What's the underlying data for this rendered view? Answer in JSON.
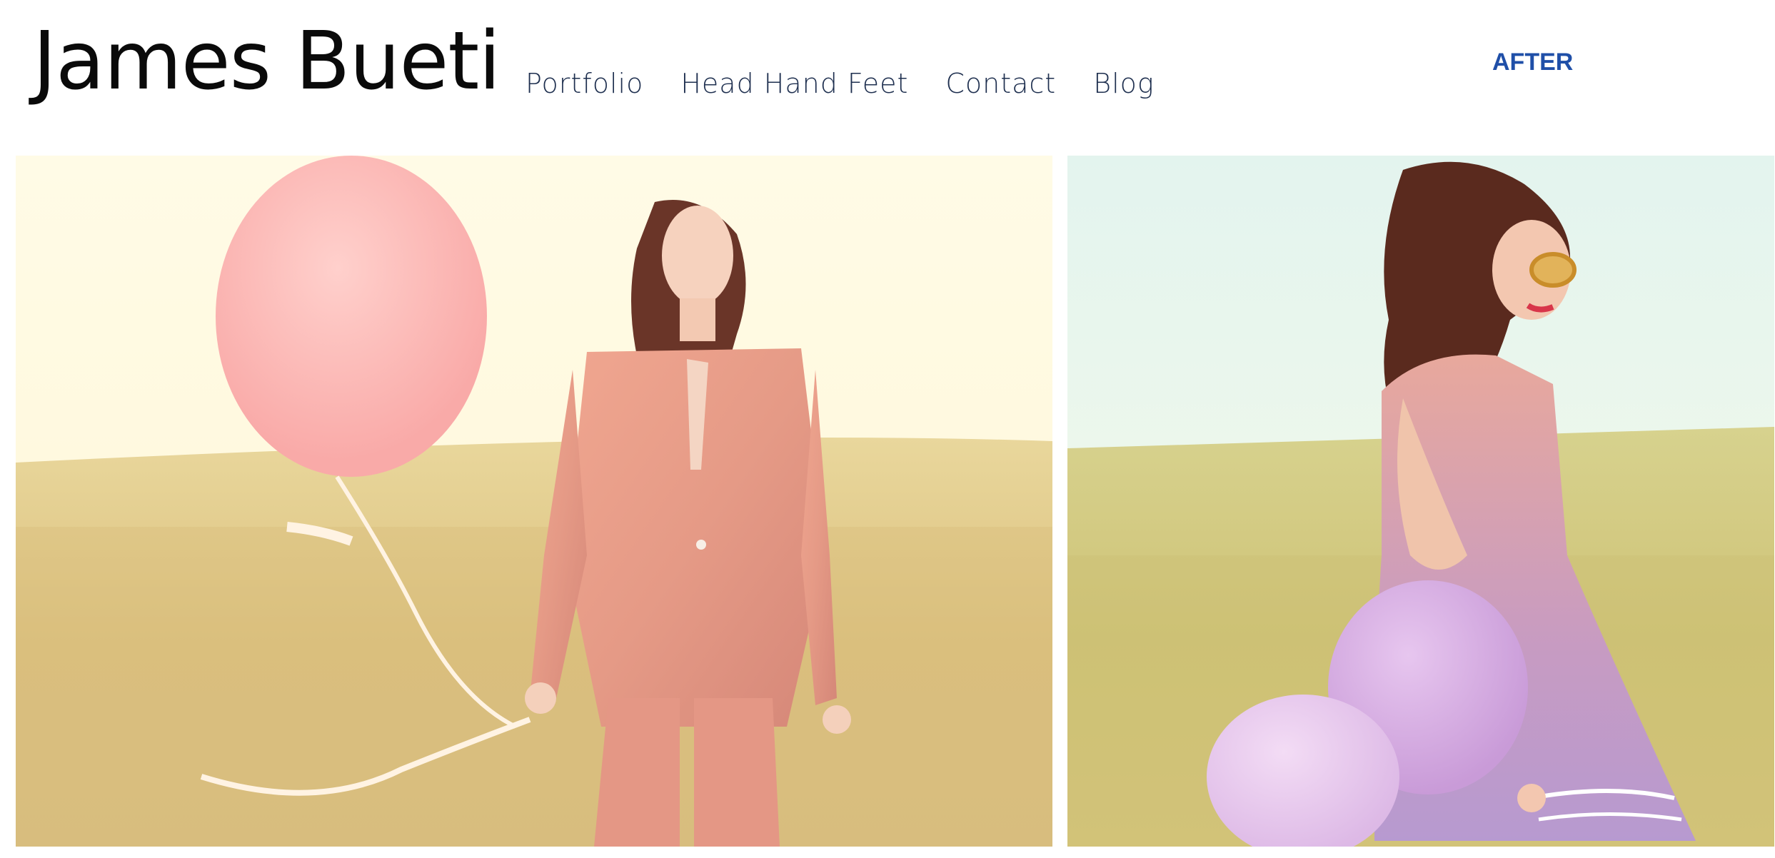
{
  "header": {
    "site_title": "James Bueti",
    "after_label": "AFTER"
  },
  "nav": {
    "items": [
      {
        "label": "Portfolio"
      },
      {
        "label": "Head Hand Feet"
      },
      {
        "label": "Contact"
      },
      {
        "label": "Blog"
      }
    ]
  },
  "colors": {
    "title": "#0a0a0a",
    "nav": "#1e2f4f",
    "after": "#1f4fa8",
    "background": "#ffffff"
  }
}
